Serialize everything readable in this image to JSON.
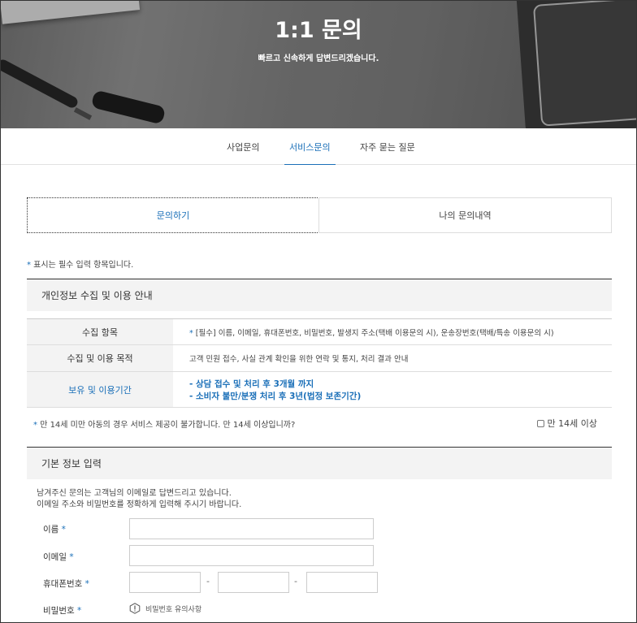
{
  "hero": {
    "title": "1:1 문의",
    "subtitle": "빠르고 신속하게 답변드리겠습니다."
  },
  "subnav": {
    "tabs": [
      {
        "label": "사업문의"
      },
      {
        "label": "서비스문의"
      },
      {
        "label": "자주 묻는 질문"
      }
    ],
    "active": "서비스문의"
  },
  "inquiry_tabs": {
    "write": "문의하기",
    "history": "나의 문의내역"
  },
  "required_note": {
    "star": "*",
    "text": " 표시는 필수 입력 항목입니다."
  },
  "privacy": {
    "title": "개인정보 수집 및 이용 안내",
    "rows": [
      {
        "label": "수집 항목",
        "value": "[필수] 이름, 이메일, 휴대폰번호, 비밀번호, 발생지 주소(택배 이용문의 시), 운송장번호(택배/특송 이용문의 시)"
      },
      {
        "label": "수집 및 이용 목적",
        "value": "고객 민원 접수, 사실 관계 확인을 위한 연락 및 통지, 처리 결과 안내"
      },
      {
        "label": "보유 및 이용기간",
        "line1": "- 상담 접수 및 처리 후 3개월 까지",
        "line2": "- 소비자 불만/분쟁 처리 후 3년(법정 보존기간)"
      }
    ]
  },
  "age": {
    "question": "만 14세 미만 아동의 경우 서비스 제공이 불가합니다. 만 14세 이상입니까?",
    "checkbox_label": "만 14세 이상"
  },
  "basic": {
    "title": "기본 정보 입력",
    "guide1": "남겨주신 문의는 고객님의 이메일로 답변드리고 있습니다.",
    "guide2": "이메일 주소와 비밀번호를 정확하게 입력해 주시기 바랍니다.",
    "name_label": "이름",
    "email_label": "이메일",
    "phone_label": "휴대폰번호",
    "password_label": "비밀번호",
    "dash": "-",
    "password_notice": "비밀번호 유의사항"
  },
  "colors": {
    "accent": "#1a6fb8"
  }
}
